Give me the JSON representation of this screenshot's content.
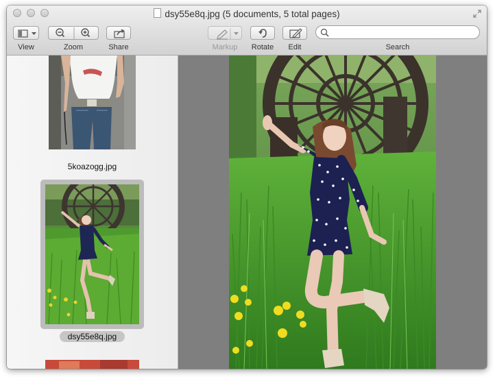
{
  "window": {
    "title": "dsy55e8q.jpg (5 documents, 5 total pages)"
  },
  "toolbar": {
    "view_label": "View",
    "zoom_label": "Zoom",
    "share_label": "Share",
    "markup_label": "Markup",
    "rotate_label": "Rotate",
    "edit_label": "Edit",
    "search_label": "Search",
    "search_placeholder": "",
    "view_icon": "sidebar-icon",
    "zoom_out_icon": "zoom-out-icon",
    "zoom_in_icon": "zoom-in-icon",
    "share_icon": "share-icon",
    "markup_icon": "pen-icon",
    "rotate_icon": "rotate-left-icon",
    "edit_icon": "pencil-box-icon"
  },
  "sidebar": {
    "items": [
      {
        "label": "5koazogg.jpg",
        "selected": false
      },
      {
        "label": "dsy55e8q.jpg",
        "selected": true
      },
      {
        "label": "",
        "selected": false
      }
    ]
  },
  "colors": {
    "window_bg": "#e9e9e9",
    "canvas_bg": "#7f7f7f",
    "selection": "#bcbcbc"
  }
}
